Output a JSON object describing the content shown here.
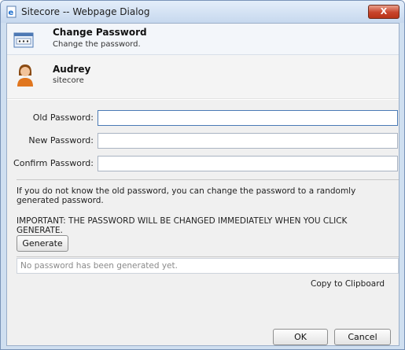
{
  "window": {
    "title": "Sitecore -- Webpage Dialog",
    "close_label": "X"
  },
  "header": {
    "title": "Change Password",
    "subtitle": "Change the password."
  },
  "user": {
    "name": "Audrey",
    "domain": "sitecore"
  },
  "form": {
    "old_label": "Old Password:",
    "old_value": "",
    "new_label": "New Password:",
    "new_value": "",
    "confirm_label": "Confirm Password:",
    "confirm_value": ""
  },
  "info": {
    "message": "If you do not know the old password, you can change the password to a randomly generated password.",
    "warning": "IMPORTANT: THE PASSWORD WILL BE CHANGED IMMEDIATELY WHEN YOU CLICK GENERATE."
  },
  "generate": {
    "button_label": "Generate",
    "output_text": "No password has been generated yet.",
    "copy_label": "Copy to Clipboard"
  },
  "footer": {
    "ok_label": "OK",
    "cancel_label": "Cancel"
  },
  "colors": {
    "title_bar": "#c6d8ee",
    "close_button": "#c8432a",
    "active_border": "#4a7ab5"
  }
}
